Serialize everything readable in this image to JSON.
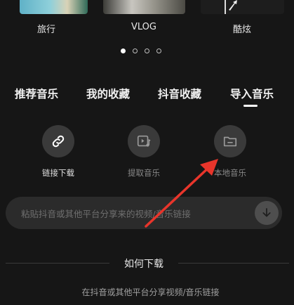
{
  "templates": [
    {
      "label": "旅行"
    },
    {
      "label": "VLOG"
    },
    {
      "label": "酷炫"
    }
  ],
  "pagination": {
    "count": 4,
    "active": 0
  },
  "tabs": [
    {
      "label": "推荐音乐"
    },
    {
      "label": "我的收藏"
    },
    {
      "label": "抖音收藏"
    },
    {
      "label": "导入音乐",
      "selected": true
    }
  ],
  "actions": [
    {
      "label": "链接下载",
      "icon": "link-icon"
    },
    {
      "label": "提取音乐",
      "icon": "extract-music-icon"
    },
    {
      "label": "本地音乐",
      "icon": "folder-icon"
    }
  ],
  "link_input": {
    "placeholder": "粘贴抖音或其他平台分享来的视频/音乐链接",
    "value": ""
  },
  "how_to": {
    "title": "如何下载",
    "description": "在抖音或其他平台分享视频/音乐链接"
  },
  "colors": {
    "background": "#161616",
    "surface": "#2b2b2b",
    "annotation_arrow": "#e8352b"
  }
}
